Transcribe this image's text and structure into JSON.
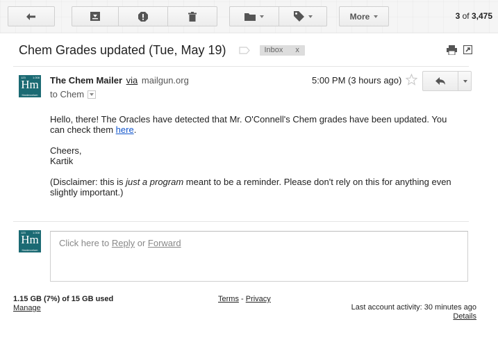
{
  "toolbar": {
    "back_icon": "back-arrow-icon",
    "archive_icon": "archive-icon",
    "spam_icon": "report-spam-icon",
    "delete_icon": "trash-icon",
    "move_icon": "folder-icon",
    "labels_icon": "label-tag-icon",
    "more_label": "More",
    "count_current": "3",
    "count_of": "of",
    "count_total": "3,475"
  },
  "message": {
    "subject": "Chem Grades updated (Tue, May 19)",
    "label": "Inbox",
    "label_remove": "x",
    "sender_name": "The Chem Mailer",
    "via": "via",
    "via_domain": "mailgun.org",
    "to_line": "to Chem",
    "time": "5:00 PM (3 hours ago)",
    "body": {
      "line1": "Hello, there! The Oracles have detected that Mr. O'Connell's Chem grades have been updated. You can check them ",
      "link": "here",
      "line1_end": ".",
      "cheers": "Cheers,",
      "signature": "Kartik",
      "disclaimer_start": "(Disclaimer: this is ",
      "disclaimer_em": "just a program",
      "disclaimer_end": " meant to be a reminder. Please don't rely on this for anything even slightly important.)"
    }
  },
  "avatar": {
    "top_left": "123",
    "top_right": "1.008",
    "symbol": "Hm",
    "name": "Hardecorium"
  },
  "reply": {
    "prefix": "Click here to ",
    "reply_link": "Reply",
    "or": " or ",
    "forward_link": "Forward"
  },
  "footer": {
    "usage": "1.15 GB (7%) of 15 GB used",
    "manage": "Manage",
    "terms": "Terms",
    "dash": " - ",
    "privacy": "Privacy",
    "activity": "Last account activity: 30 minutes ago",
    "details": "Details"
  },
  "colors": {
    "avatar_bg": "#1b6a73",
    "link": "#1155cc",
    "label_chip": "#dddddd"
  }
}
